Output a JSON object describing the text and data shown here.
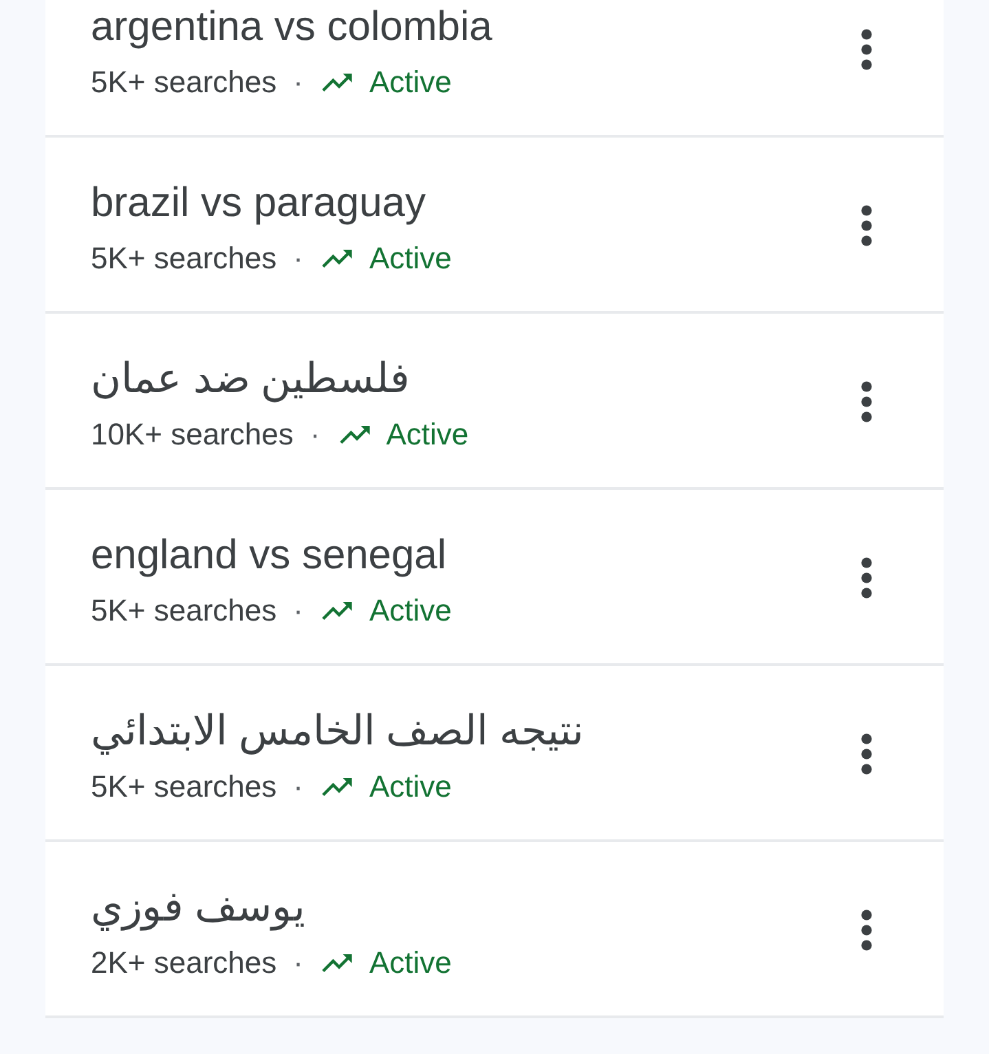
{
  "trends": [
    {
      "title": "argentina vs colombia",
      "searches": "5K+ searches",
      "separator": "·",
      "status": "Active"
    },
    {
      "title": "brazil vs paraguay",
      "searches": "5K+ searches",
      "separator": "·",
      "status": "Active"
    },
    {
      "title": "فلسطين ضد عمان",
      "searches": "10K+ searches",
      "separator": "·",
      "status": "Active"
    },
    {
      "title": "england vs senegal",
      "searches": "5K+ searches",
      "separator": "·",
      "status": "Active"
    },
    {
      "title": "نتيجه الصف الخامس الابتدائي",
      "searches": "5K+ searches",
      "separator": "·",
      "status": "Active"
    },
    {
      "title": "يوسف فوزي",
      "searches": "2K+ searches",
      "separator": "·",
      "status": "Active"
    }
  ]
}
